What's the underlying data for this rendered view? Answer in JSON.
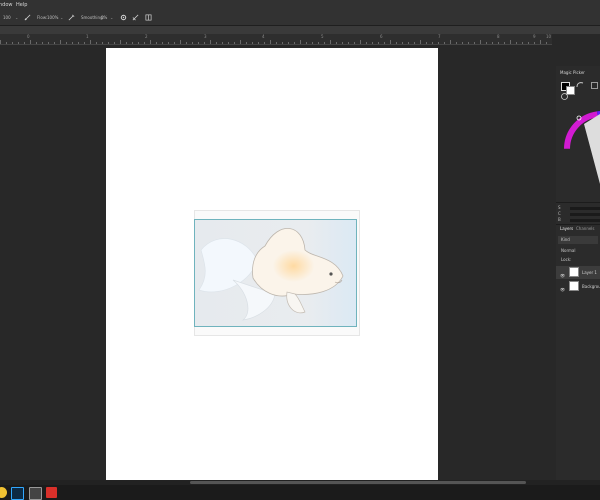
{
  "menu": {
    "items": [
      "ndow",
      "Help"
    ]
  },
  "options": {
    "size_value": "100",
    "flow_label": "Flow:",
    "flow_value": "100%",
    "smoothing_label": "Smoothing:",
    "smoothing_value": "0%"
  },
  "ruler": {
    "numbers": [
      "0",
      "1",
      "2",
      "3",
      "4",
      "5",
      "6",
      "7",
      "8",
      "9",
      "10"
    ]
  },
  "right_panel": {
    "title": "Magic Picker",
    "tabs": [
      "Layers",
      "Channels"
    ],
    "filter": "Kind",
    "blend_mode": "Normal",
    "lock_label": "Lock:",
    "slider_labels": [
      "S",
      "C",
      "B"
    ],
    "layers": [
      {
        "name": "Layer 1"
      },
      {
        "name": "Background"
      }
    ]
  },
  "colors": {
    "accent": "#2fa6b8",
    "panel": "#323232",
    "canvas_bg": "#282828"
  },
  "taskbar": {
    "apps": [
      "chrome-icon",
      "photoshop-icon",
      "finder-icon",
      "red-app-icon"
    ]
  }
}
